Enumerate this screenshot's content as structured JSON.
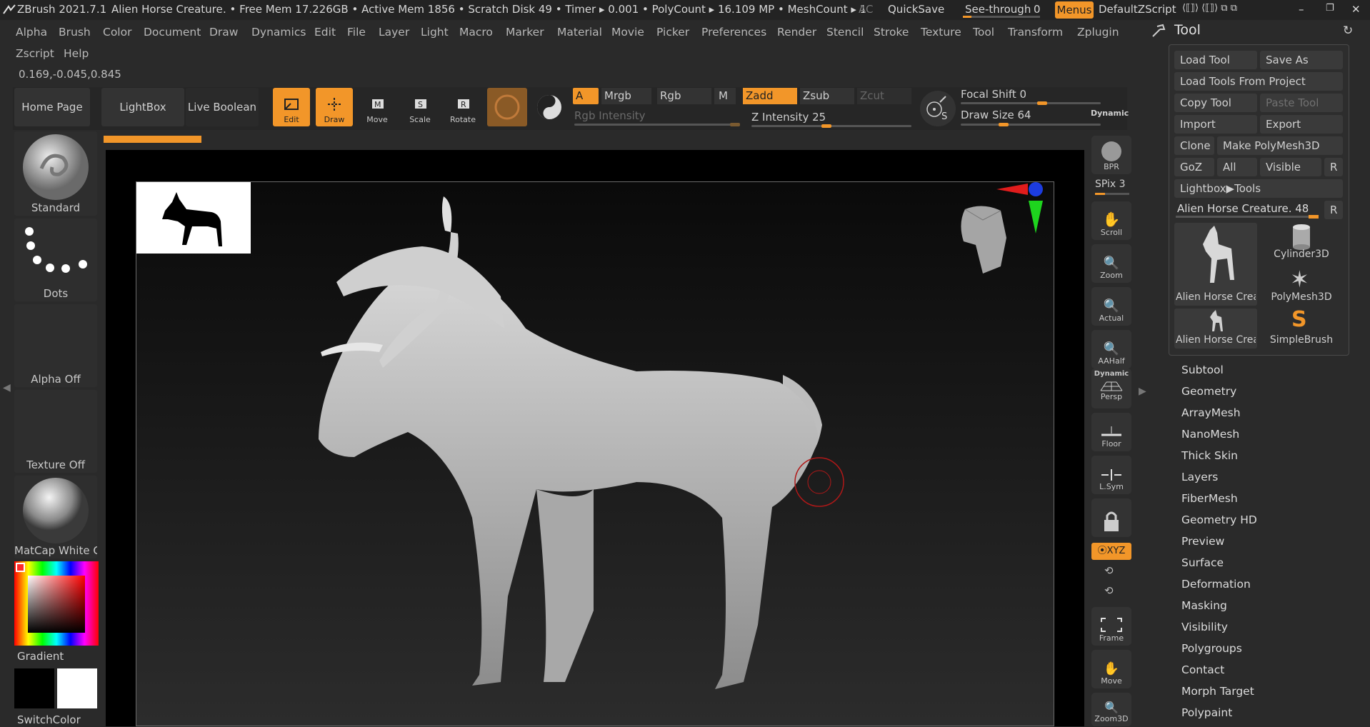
{
  "titlebar": {
    "app": "ZBrush 2021.7.1",
    "doc": "Alien Horse Creature",
    "stats": ". • Free Mem 17.226GB • Active Mem 1856 • Scratch Disk 49 •  Timer ▸ 0.001 • PolyCount ▸ 16.109 MP  • MeshCount ▸ 1",
    "ac": "AC",
    "quicksave": "QuickSave",
    "seethrough": "See-through",
    "seethrough_value": "0",
    "menus": "Menus",
    "script": "DefaultZScript"
  },
  "menu": {
    "row1": [
      "Alpha",
      "Brush",
      "Color",
      "Document",
      "Draw",
      "Dynamics",
      "Edit",
      "File",
      "Layer",
      "Light",
      "Macro",
      "Marker",
      "Material",
      "Movie",
      "Picker",
      "Preferences",
      "Render",
      "Stencil",
      "Stroke",
      "Texture",
      "Tool",
      "Transform",
      "Zplugin"
    ],
    "row2": [
      "Zscript",
      "Help"
    ]
  },
  "coords": "0.169,-0.045,0.845",
  "toolbar": {
    "home": "Home Page",
    "lightbox": "LightBox",
    "liveboolean": "Live Boolean",
    "edit": "Edit",
    "draw": "Draw",
    "move": "Move",
    "scale": "Scale",
    "rotate": "Rotate",
    "a": "A",
    "mrgb": "Mrgb",
    "rgb": "Rgb",
    "m": "M",
    "zadd": "Zadd",
    "zsub": "Zsub",
    "zcut": "Zcut",
    "rgb_intensity": "Rgb Intensity",
    "z_intensity": "Z Intensity 25",
    "focal_shift": "Focal Shift 0",
    "draw_size": "Draw Size 64",
    "dynamic": "Dynamic",
    "s": "S"
  },
  "left": {
    "brush": "Standard",
    "stroke": "Dots",
    "alpha": "Alpha Off",
    "texture": "Texture Off",
    "material": "MatCap White C",
    "gradient": "Gradient",
    "switch": "SwitchColor"
  },
  "shelf": {
    "bpr": "BPR",
    "spix": "SPix 3",
    "scroll": "Scroll",
    "zoom": "Zoom",
    "actual": "Actual",
    "aahalf": "AAHalf",
    "dynamic": "Dynamic",
    "persp": "Persp",
    "floor": "Floor",
    "lsym": "L.Sym",
    "xyz": "⦿XYZ",
    "frame": "Frame",
    "move": "Move",
    "zoom3d": "Zoom3D"
  },
  "tool": {
    "title": "Tool",
    "load": "Load Tool",
    "saveas": "Save As",
    "loadproject": "Load Tools From Project",
    "copy": "Copy Tool",
    "paste": "Paste Tool",
    "import": "Import",
    "export": "Export",
    "clone": "Clone",
    "makepoly": "Make PolyMesh3D",
    "goz": "GoZ",
    "all": "All",
    "visible": "Visible",
    "r": "R",
    "lightbox_tools": "Lightbox▶Tools",
    "current": "Alien Horse Creature. 48",
    "thumbs": [
      "Alien Horse Crea",
      "Cylinder3D",
      "PolyMesh3D",
      "Alien Horse Crea",
      "SimpleBrush"
    ],
    "sections": [
      "Subtool",
      "Geometry",
      "ArrayMesh",
      "NanoMesh",
      "Thick Skin",
      "Layers",
      "FiberMesh",
      "Geometry HD",
      "Preview",
      "Surface",
      "Deformation",
      "Masking",
      "Visibility",
      "Polygroups",
      "Contact",
      "Morph Target",
      "Polypaint"
    ]
  },
  "colors": {
    "accent": "#f29629",
    "bg": "#2a2a2a",
    "panel": "#3a3a3a"
  }
}
